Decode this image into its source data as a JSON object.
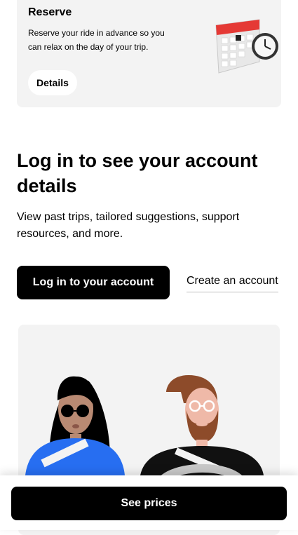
{
  "reserve": {
    "title": "Reserve",
    "description": "Reserve your ride in advance so you can relax on the day of your trip.",
    "details_label": "Details",
    "illustration": "calendar-clock-icon"
  },
  "login": {
    "heading": "Log in to see your account details",
    "description": "View past trips, tailored suggestions, support resources, and more.",
    "login_button": "Log in to your account",
    "create_link": "Create an account"
  },
  "illustration": {
    "subject": "rider-and-driver-illustration"
  },
  "bottom_bar": {
    "see_prices_label": "See prices"
  },
  "colors": {
    "primary": "#000000",
    "card_background": "#f3f3f3",
    "accent_blue": "#276ef1",
    "accent_red": "#e11900"
  }
}
